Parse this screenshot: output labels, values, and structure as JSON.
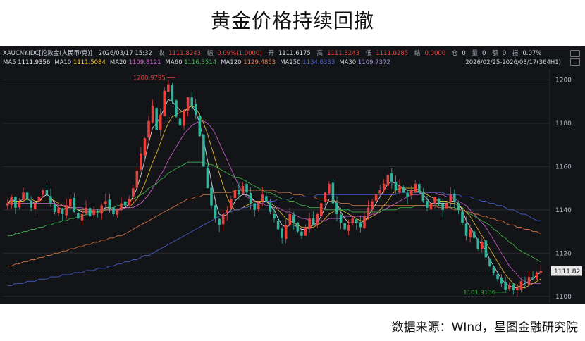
{
  "title": "黄金价格持续回撤",
  "source": "数据来源：WInd，星图金融研究院",
  "header": {
    "symbol": "XAUCNY.IDC[伦敦金(人民币/克)]",
    "datetime": "2026/03/17 15:32",
    "close_label": "收",
    "close": "1111.8243",
    "change_label": "幅",
    "change": "0.09%(1.0000)",
    "open_label": "开",
    "open": "1111.6175",
    "high_label": "高",
    "high": "1111.8243",
    "low_label": "低",
    "low": "1111.0285",
    "settle_label": "结",
    "settle": "0.0000",
    "oi_label": "仓",
    "oi": "0",
    "vol_label": "量",
    "vol": "0",
    "amt_label": "额",
    "amt": "0",
    "turnover_label": "振",
    "turnover": "0.07%",
    "range": "2026/02/25-2026/03/17(364H1)"
  },
  "ma_legend": [
    {
      "label": "MA5",
      "value": "1111.9356",
      "color": "#e8e8e8"
    },
    {
      "label": "MA10",
      "value": "1111.5084",
      "color": "#f2c230"
    },
    {
      "label": "MA20",
      "value": "1109.8121",
      "color": "#d35fd3"
    },
    {
      "label": "MA60",
      "value": "1116.3514",
      "color": "#3fbf4a"
    },
    {
      "label": "MA120",
      "value": "1129.4853",
      "color": "#e07a45"
    },
    {
      "label": "MA250",
      "value": "1134.6333",
      "color": "#4a62d8"
    },
    {
      "label": "MA30",
      "value": "1109.7372",
      "color": "#9a8fd0"
    }
  ],
  "chart_data": {
    "type": "candlestick",
    "y_ticks": [
      "1200",
      "1180",
      "1160",
      "1140",
      "1120",
      "1100"
    ],
    "ylim": [
      1097,
      1205
    ],
    "current_price_label": "1111.82",
    "max_annotation": "1200.9795",
    "min_annotation": "1101.9136",
    "up_color": "#e8413c",
    "down_color": "#2fb39a",
    "grid": true,
    "close_series": [
      1143,
      1146,
      1141,
      1144,
      1148,
      1145,
      1141,
      1143,
      1146,
      1149,
      1147,
      1143,
      1139,
      1141,
      1138,
      1142,
      1145,
      1139,
      1136,
      1138,
      1141,
      1137,
      1140,
      1139,
      1142,
      1144,
      1141,
      1138,
      1140,
      1143,
      1142,
      1145,
      1150,
      1158,
      1166,
      1173,
      1181,
      1188,
      1177,
      1184,
      1195,
      1198,
      1190,
      1183,
      1179,
      1186,
      1192,
      1188,
      1184,
      1174,
      1160,
      1150,
      1142,
      1136,
      1133,
      1138,
      1140,
      1145,
      1149,
      1147,
      1151,
      1148,
      1143,
      1140,
      1144,
      1147,
      1144,
      1139,
      1136,
      1131,
      1127,
      1133,
      1138,
      1134,
      1130,
      1128,
      1132,
      1136,
      1133,
      1138,
      1143,
      1148,
      1152,
      1143,
      1138,
      1134,
      1131,
      1133,
      1136,
      1134,
      1132,
      1137,
      1141,
      1144,
      1147,
      1149,
      1152,
      1156,
      1153,
      1149,
      1151,
      1148,
      1146,
      1149,
      1152,
      1148,
      1144,
      1141,
      1143,
      1146,
      1143,
      1140,
      1143,
      1147,
      1144,
      1140,
      1134,
      1128,
      1131,
      1127,
      1122,
      1125,
      1118,
      1114,
      1111,
      1108,
      1106,
      1103,
      1105,
      1103,
      1104,
      1107,
      1106,
      1109,
      1108,
      1111,
      1112
    ],
    "ma_series": {
      "MA5": [
        1143,
        1145,
        1144,
        1144,
        1145,
        1145,
        1144,
        1143,
        1144,
        1146,
        1147,
        1146,
        1143,
        1141,
        1140,
        1141,
        1141,
        1141,
        1140,
        1139,
        1139,
        1139,
        1139,
        1139,
        1140,
        1141,
        1141,
        1140,
        1140,
        1141,
        1141,
        1143,
        1146,
        1150,
        1156,
        1163,
        1171,
        1178,
        1180,
        1183,
        1187,
        1191,
        1190,
        1188,
        1186,
        1185,
        1187,
        1188,
        1185,
        1180,
        1172,
        1163,
        1153,
        1144,
        1138,
        1137,
        1138,
        1140,
        1144,
        1146,
        1147,
        1147,
        1146,
        1144,
        1143,
        1144,
        1144,
        1142,
        1140,
        1136,
        1133,
        1132,
        1133,
        1133,
        1132,
        1131,
        1131,
        1132,
        1133,
        1134,
        1137,
        1141,
        1145,
        1145,
        1143,
        1139,
        1136,
        1134,
        1134,
        1134,
        1134,
        1135,
        1137,
        1140,
        1143,
        1146,
        1149,
        1152,
        1153,
        1152,
        1151,
        1150,
        1149,
        1149,
        1149,
        1148,
        1147,
        1145,
        1143,
        1143,
        1143,
        1143,
        1143,
        1144,
        1144,
        1143,
        1140,
        1135,
        1132,
        1129,
        1126,
        1124,
        1121,
        1117,
        1114,
        1111,
        1108,
        1106,
        1105,
        1104,
        1104,
        1105,
        1106,
        1107,
        1108,
        1110,
        1111
      ],
      "MA10": [
        1143,
        1144,
        1144,
        1144,
        1144,
        1145,
        1145,
        1144,
        1144,
        1145,
        1145,
        1145,
        1144,
        1143,
        1142,
        1141,
        1141,
        1141,
        1140,
        1140,
        1140,
        1140,
        1139,
        1139,
        1139,
        1140,
        1140,
        1140,
        1140,
        1140,
        1141,
        1141,
        1143,
        1145,
        1148,
        1152,
        1157,
        1162,
        1166,
        1171,
        1176,
        1180,
        1183,
        1184,
        1185,
        1186,
        1187,
        1188,
        1187,
        1184,
        1180,
        1175,
        1169,
        1163,
        1157,
        1151,
        1146,
        1142,
        1140,
        1140,
        1141,
        1142,
        1143,
        1144,
        1144,
        1144,
        1144,
        1143,
        1142,
        1140,
        1138,
        1136,
        1135,
        1134,
        1133,
        1132,
        1132,
        1132,
        1132,
        1133,
        1134,
        1136,
        1138,
        1139,
        1140,
        1140,
        1139,
        1138,
        1137,
        1136,
        1135,
        1135,
        1136,
        1137,
        1138,
        1140,
        1142,
        1144,
        1147,
        1149,
        1150,
        1150,
        1150,
        1150,
        1150,
        1149,
        1148,
        1147,
        1146,
        1145,
        1144,
        1144,
        1144,
        1143,
        1143,
        1142,
        1141,
        1139,
        1137,
        1134,
        1131,
        1128,
        1125,
        1122,
        1119,
        1116,
        1113,
        1110,
        1108,
        1106,
        1105,
        1104,
        1104,
        1105,
        1106,
        1107,
        1108
      ],
      "MA20": [
        1143,
        1143,
        1143,
        1143,
        1143,
        1143,
        1143,
        1143,
        1143,
        1143,
        1143,
        1143,
        1143,
        1142,
        1142,
        1142,
        1141,
        1141,
        1141,
        1141,
        1140,
        1140,
        1140,
        1140,
        1140,
        1140,
        1140,
        1140,
        1140,
        1140,
        1141,
        1141,
        1141,
        1142,
        1143,
        1145,
        1147,
        1150,
        1153,
        1156,
        1159,
        1163,
        1166,
        1169,
        1172,
        1175,
        1177,
        1179,
        1180,
        1181,
        1181,
        1180,
        1178,
        1175,
        1171,
        1167,
        1163,
        1159,
        1155,
        1151,
        1148,
        1146,
        1145,
        1144,
        1143,
        1143,
        1142,
        1142,
        1141,
        1141,
        1140,
        1139,
        1139,
        1138,
        1137,
        1136,
        1136,
        1135,
        1135,
        1135,
        1135,
        1135,
        1136,
        1136,
        1136,
        1136,
        1137,
        1137,
        1137,
        1137,
        1137,
        1137,
        1137,
        1138,
        1138,
        1139,
        1140,
        1141,
        1142,
        1143,
        1144,
        1145,
        1146,
        1147,
        1147,
        1147,
        1148,
        1148,
        1148,
        1148,
        1147,
        1147,
        1146,
        1146,
        1145,
        1144,
        1143,
        1142,
        1140,
        1138,
        1136,
        1134,
        1132,
        1129,
        1126,
        1123,
        1120,
        1117,
        1114,
        1112,
        1110,
        1108,
        1107,
        1106,
        1106,
        1106,
        1106
      ],
      "MA60": [
        1128,
        1128,
        1129,
        1129,
        1130,
        1130,
        1131,
        1131,
        1132,
        1132,
        1133,
        1133,
        1134,
        1134,
        1135,
        1135,
        1136,
        1136,
        1137,
        1137,
        1138,
        1138,
        1139,
        1139,
        1140,
        1140,
        1141,
        1141,
        1142,
        1142,
        1143,
        1144,
        1145,
        1146,
        1147,
        1148,
        1150,
        1151,
        1152,
        1154,
        1155,
        1157,
        1158,
        1159,
        1160,
        1161,
        1162,
        1162,
        1162,
        1162,
        1162,
        1161,
        1161,
        1160,
        1159,
        1158,
        1157,
        1156,
        1155,
        1155,
        1154,
        1153,
        1152,
        1151,
        1150,
        1149,
        1148,
        1148,
        1147,
        1146,
        1145,
        1145,
        1144,
        1144,
        1143,
        1142,
        1142,
        1141,
        1141,
        1141,
        1141,
        1140,
        1140,
        1140,
        1140,
        1140,
        1140,
        1140,
        1139,
        1139,
        1139,
        1139,
        1139,
        1139,
        1139,
        1139,
        1140,
        1140,
        1140,
        1140,
        1141,
        1141,
        1141,
        1141,
        1142,
        1142,
        1142,
        1142,
        1142,
        1142,
        1142,
        1142,
        1142,
        1141,
        1141,
        1140,
        1140,
        1139,
        1138,
        1137,
        1136,
        1135,
        1134,
        1133,
        1131,
        1130,
        1128,
        1127,
        1125,
        1124,
        1122,
        1121,
        1120,
        1119,
        1118,
        1117,
        1116
      ],
      "MA120": [
        1114,
        1114,
        1115,
        1115,
        1116,
        1116,
        1117,
        1117,
        1118,
        1118,
        1119,
        1119,
        1120,
        1120,
        1121,
        1121,
        1122,
        1122,
        1123,
        1123,
        1124,
        1124,
        1125,
        1125,
        1126,
        1126,
        1127,
        1127,
        1128,
        1128,
        1129,
        1130,
        1131,
        1132,
        1133,
        1134,
        1135,
        1136,
        1137,
        1138,
        1139,
        1140,
        1141,
        1142,
        1143,
        1144,
        1145,
        1145,
        1146,
        1146,
        1147,
        1147,
        1147,
        1148,
        1148,
        1148,
        1148,
        1148,
        1149,
        1149,
        1149,
        1149,
        1149,
        1149,
        1149,
        1149,
        1149,
        1149,
        1149,
        1148,
        1148,
        1148,
        1148,
        1147,
        1147,
        1147,
        1146,
        1146,
        1146,
        1145,
        1145,
        1145,
        1144,
        1144,
        1144,
        1143,
        1143,
        1143,
        1142,
        1142,
        1142,
        1142,
        1142,
        1142,
        1142,
        1142,
        1142,
        1142,
        1142,
        1142,
        1142,
        1142,
        1142,
        1142,
        1142,
        1142,
        1142,
        1142,
        1142,
        1142,
        1141,
        1141,
        1141,
        1141,
        1140,
        1140,
        1140,
        1139,
        1139,
        1138,
        1138,
        1137,
        1137,
        1136,
        1136,
        1135,
        1135,
        1134,
        1133,
        1133,
        1132,
        1132,
        1131,
        1131,
        1130,
        1130,
        1129
      ],
      "MA250": [
        1105,
        1105,
        1106,
        1106,
        1106,
        1107,
        1107,
        1107,
        1108,
        1108,
        1108,
        1109,
        1109,
        1109,
        1110,
        1110,
        1110,
        1111,
        1111,
        1111,
        1112,
        1112,
        1112,
        1113,
        1113,
        1113,
        1114,
        1114,
        1115,
        1115,
        1116,
        1116,
        1117,
        1117,
        1118,
        1119,
        1119,
        1120,
        1121,
        1122,
        1123,
        1124,
        1125,
        1126,
        1127,
        1128,
        1129,
        1130,
        1131,
        1132,
        1133,
        1134,
        1135,
        1136,
        1137,
        1138,
        1139,
        1139,
        1140,
        1140,
        1141,
        1141,
        1142,
        1142,
        1143,
        1143,
        1144,
        1144,
        1144,
        1145,
        1145,
        1145,
        1145,
        1146,
        1146,
        1146,
        1146,
        1146,
        1146,
        1147,
        1147,
        1147,
        1147,
        1147,
        1147,
        1147,
        1147,
        1147,
        1147,
        1147,
        1147,
        1147,
        1147,
        1147,
        1147,
        1147,
        1147,
        1147,
        1147,
        1147,
        1148,
        1148,
        1148,
        1148,
        1148,
        1148,
        1148,
        1148,
        1148,
        1148,
        1148,
        1148,
        1147,
        1147,
        1147,
        1147,
        1146,
        1146,
        1146,
        1145,
        1145,
        1144,
        1144,
        1143,
        1143,
        1142,
        1142,
        1141,
        1140,
        1140,
        1139,
        1138,
        1138,
        1137,
        1136,
        1135,
        1135
      ]
    }
  }
}
